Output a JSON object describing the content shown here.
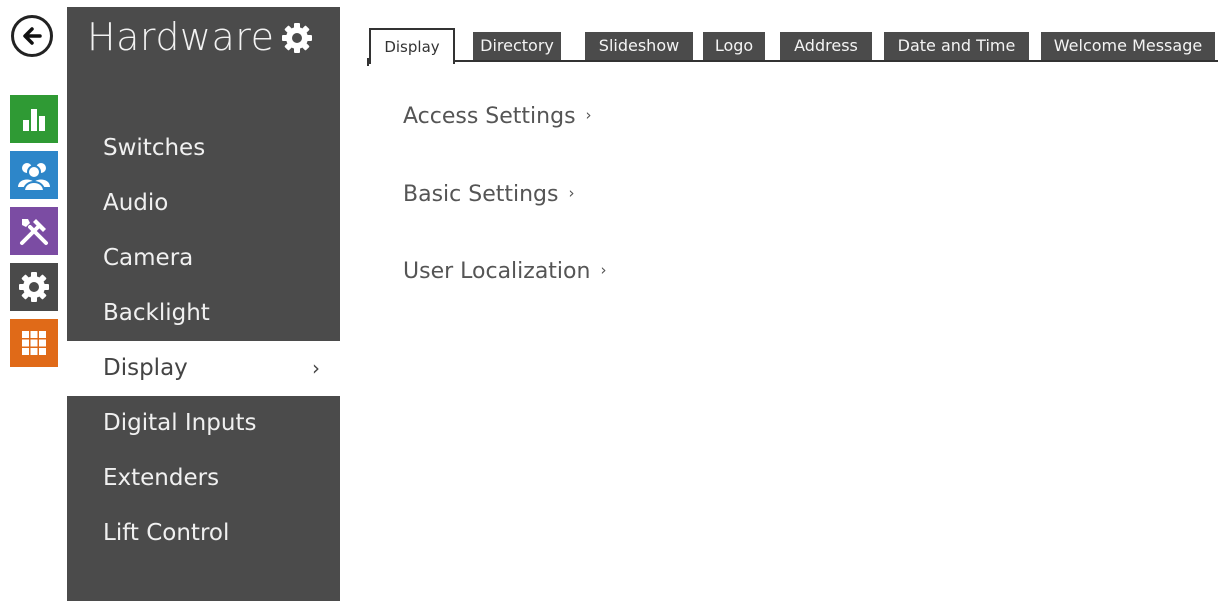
{
  "rail": {
    "back_icon": "arrow-left-icon",
    "tiles": [
      {
        "name": "status",
        "icon": "bar-chart-icon",
        "color": "#2f9a34"
      },
      {
        "name": "directory",
        "icon": "users-icon",
        "color": "#2d86c9"
      },
      {
        "name": "services",
        "icon": "tools-icon",
        "color": "#7b4ca3"
      },
      {
        "name": "system",
        "icon": "gear-icon",
        "color": "#4a4a4a"
      },
      {
        "name": "applications",
        "icon": "grid-icon",
        "color": "#e06a18"
      }
    ]
  },
  "sidebar": {
    "title": "Hardware",
    "items": [
      {
        "label": "Switches"
      },
      {
        "label": "Audio"
      },
      {
        "label": "Camera"
      },
      {
        "label": "Backlight"
      },
      {
        "label": "Display",
        "active": true,
        "chevron": "›"
      },
      {
        "label": "Digital Inputs"
      },
      {
        "label": "Extenders"
      },
      {
        "label": "Lift Control"
      }
    ]
  },
  "tabs": [
    {
      "label": "Display",
      "active": true
    },
    {
      "label": "Directory"
    },
    {
      "label": "Slideshow"
    },
    {
      "label": "Logo"
    },
    {
      "label": "Address"
    },
    {
      "label": "Date and Time"
    },
    {
      "label": "Welcome Message"
    }
  ],
  "sections": [
    {
      "label": "Access Settings",
      "chevron": "›"
    },
    {
      "label": "Basic Settings",
      "chevron": "›"
    },
    {
      "label": "User Localization",
      "chevron": "›"
    }
  ]
}
